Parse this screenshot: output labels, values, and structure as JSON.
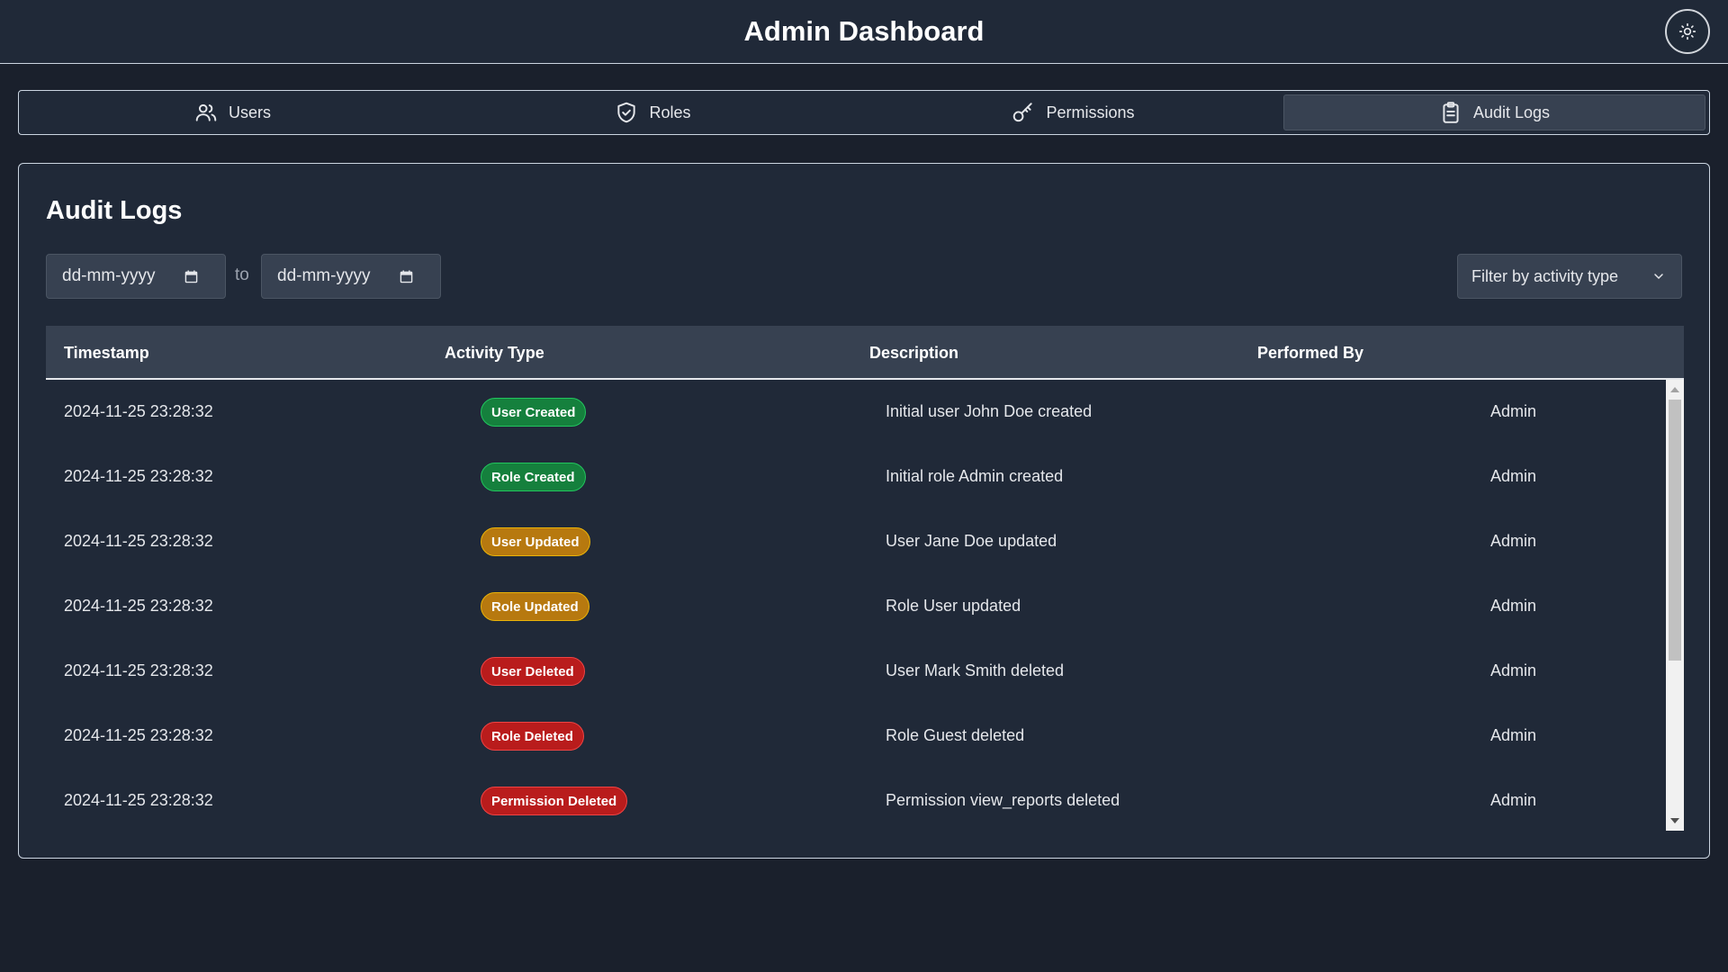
{
  "header": {
    "title": "Admin Dashboard",
    "theme_toggle_icon": "sun-icon"
  },
  "tabs": [
    {
      "label": "Users",
      "icon": "users-icon",
      "active": false
    },
    {
      "label": "Roles",
      "icon": "shield-icon",
      "active": false
    },
    {
      "label": "Permissions",
      "icon": "key-icon",
      "active": false
    },
    {
      "label": "Audit Logs",
      "icon": "clipboard-icon",
      "active": true
    }
  ],
  "audit": {
    "title": "Audit Logs",
    "date_from_placeholder": "dd-mm-yyyy",
    "date_separator": "to",
    "date_to_placeholder": "dd-mm-yyyy",
    "filter_placeholder": "Filter by activity type",
    "columns": [
      "Timestamp",
      "Activity Type",
      "Description",
      "Performed By"
    ],
    "rows": [
      {
        "timestamp": "2024-11-25 23:28:32",
        "activity": "User Created",
        "status": "green",
        "description": "Initial user John Doe created",
        "performed_by": "Admin"
      },
      {
        "timestamp": "2024-11-25 23:28:32",
        "activity": "Role Created",
        "status": "green",
        "description": "Initial role Admin created",
        "performed_by": "Admin"
      },
      {
        "timestamp": "2024-11-25 23:28:32",
        "activity": "User Updated",
        "status": "amber",
        "description": "User Jane Doe updated",
        "performed_by": "Admin"
      },
      {
        "timestamp": "2024-11-25 23:28:32",
        "activity": "Role Updated",
        "status": "amber",
        "description": "Role User updated",
        "performed_by": "Admin"
      },
      {
        "timestamp": "2024-11-25 23:28:32",
        "activity": "User Deleted",
        "status": "red",
        "description": "User Mark Smith deleted",
        "performed_by": "Admin"
      },
      {
        "timestamp": "2024-11-25 23:28:32",
        "activity": "Role Deleted",
        "status": "red",
        "description": "Role Guest deleted",
        "performed_by": "Admin"
      },
      {
        "timestamp": "2024-11-25 23:28:32",
        "activity": "Permission Deleted",
        "status": "red",
        "description": "Permission view_reports deleted",
        "performed_by": "Admin"
      }
    ]
  },
  "colors": {
    "background": "#1a202c",
    "surface": "#202938",
    "created": "#15803d",
    "updated": "#b7790f",
    "deleted": "#b91c1c"
  }
}
